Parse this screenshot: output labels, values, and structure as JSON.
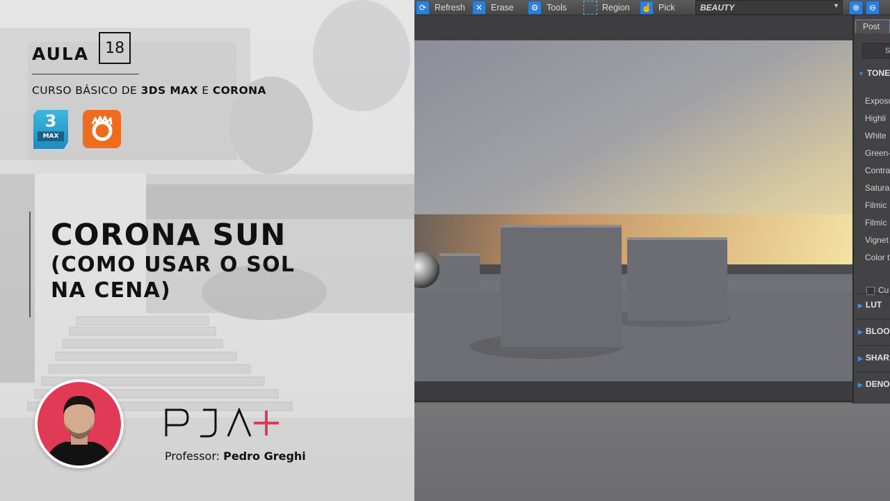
{
  "lesson": {
    "aula_label": "AULA",
    "aula_number": "18",
    "course_prefix": "CURSO BÁSICO DE ",
    "course_app1": "3DS MAX",
    "course_mid": " E ",
    "course_app2": "CORONA",
    "title_line1": "CORONA SUN",
    "title_line2": "(COMO USAR O SOL",
    "title_line3": "NA CENA)",
    "brand_text": "PJA+",
    "professor_prefix": "Professor: ",
    "professor_name": "Pedro Greghi"
  },
  "logos": {
    "max_number": "3",
    "max_label": "MAX"
  },
  "toolbar": {
    "refresh_label": "Refresh",
    "erase_label": "Erase",
    "tools_label": "Tools",
    "region_label": "Region",
    "pick_label": "Pick",
    "channel_value": "BEAUTY"
  },
  "side_panel": {
    "post_tab": "Post",
    "button_label": "S",
    "tone_section": "TONE",
    "props": [
      "Exposu",
      "Highli",
      "White",
      "Green-",
      "Contra",
      "Satura",
      "Filmic",
      "Filmic",
      "Vignet",
      "Color t"
    ],
    "checkbox_label": "Cu",
    "lut_section": "LUT",
    "bloom_section": "BLOO",
    "sharp_section": "SHAR",
    "denoise_section": "DENO"
  },
  "colors": {
    "accent_red": "#e03a56",
    "corona_orange": "#ef6c1f",
    "max_blue": "#1f8bbd",
    "ui_blue": "#2f7fd6"
  }
}
